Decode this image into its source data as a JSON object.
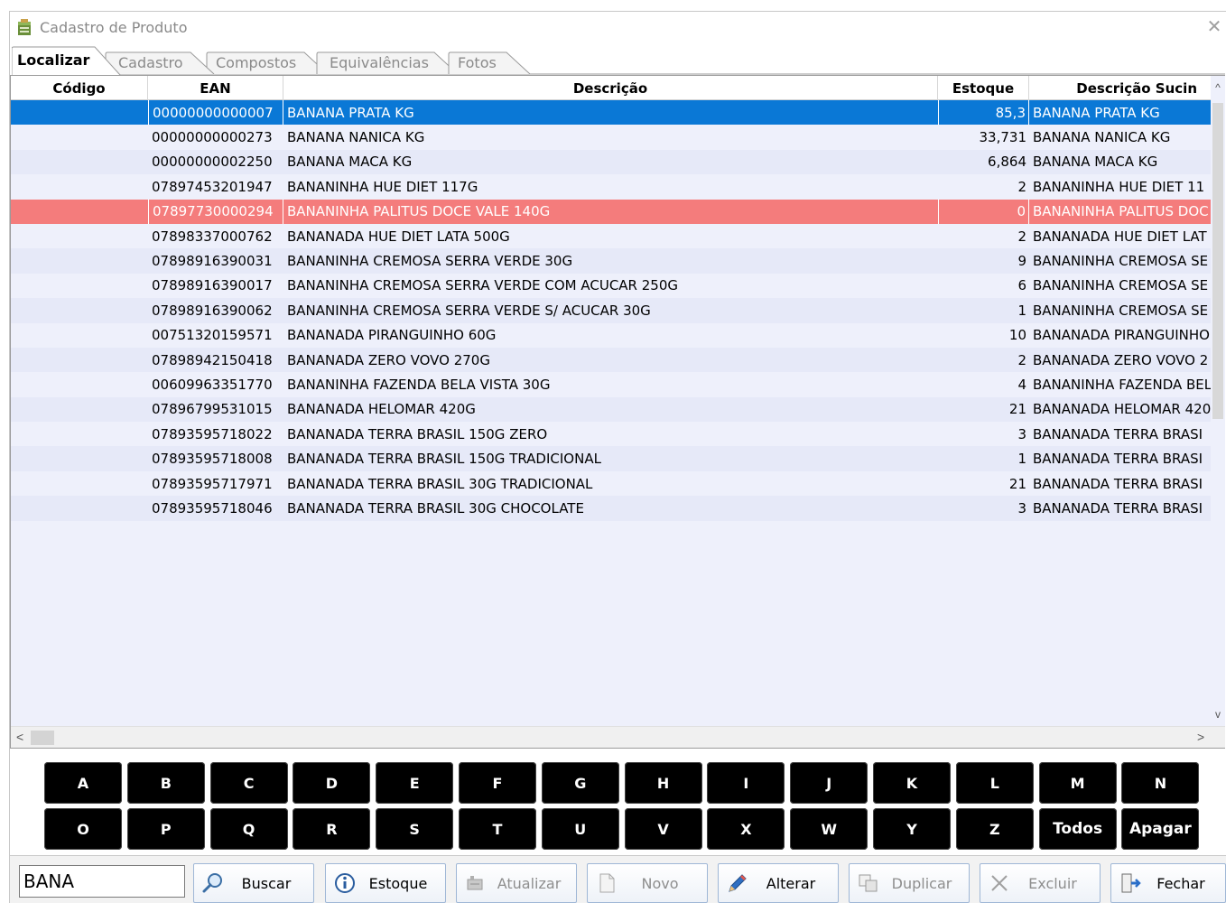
{
  "window": {
    "title": "Cadastro de Produto",
    "close_glyph": "✕"
  },
  "tabs": [
    {
      "label": "Localizar",
      "active": true
    },
    {
      "label": "Cadastro",
      "active": false
    },
    {
      "label": "Compostos",
      "active": false
    },
    {
      "label": "Equivalências",
      "active": false
    },
    {
      "label": "Fotos",
      "active": false
    }
  ],
  "grid": {
    "columns": [
      "Código",
      "EAN",
      "Descrição",
      "Estoque",
      "Descrição Sucin"
    ],
    "rows": [
      {
        "codigo": "",
        "ean": "00000000000007",
        "descricao": "BANANA PRATA KG",
        "estoque": "85,3",
        "desc_suc": "BANANA PRATA KG",
        "state": "selected"
      },
      {
        "codigo": "",
        "ean": "00000000000273",
        "descricao": "BANANA NANICA KG",
        "estoque": "33,731",
        "desc_suc": "BANANA NANICA KG",
        "state": "normal"
      },
      {
        "codigo": "",
        "ean": "00000000002250",
        "descricao": "BANANA MACA KG",
        "estoque": "6,864",
        "desc_suc": "BANANA MACA KG",
        "state": "normal"
      },
      {
        "codigo": "",
        "ean": "07897453201947",
        "descricao": "BANANINHA HUE DIET 117G",
        "estoque": "2",
        "desc_suc": "BANANINHA HUE DIET 11",
        "state": "normal"
      },
      {
        "codigo": "",
        "ean": "07897730000294",
        "descricao": "BANANINHA PALITUS DOCE VALE 140G",
        "estoque": "0",
        "desc_suc": "BANANINHA PALITUS DOC",
        "state": "alert"
      },
      {
        "codigo": "",
        "ean": "07898337000762",
        "descricao": "BANANADA HUE DIET LATA 500G",
        "estoque": "2",
        "desc_suc": "BANANADA HUE DIET LAT",
        "state": "normal"
      },
      {
        "codigo": "",
        "ean": "07898916390031",
        "descricao": "BANANINHA CREMOSA SERRA VERDE 30G",
        "estoque": "9",
        "desc_suc": "BANANINHA CREMOSA SE",
        "state": "normal"
      },
      {
        "codigo": "",
        "ean": "07898916390017",
        "descricao": "BANANINHA CREMOSA SERRA VERDE COM ACUCAR 250G",
        "estoque": "6",
        "desc_suc": "BANANINHA CREMOSA SE",
        "state": "normal"
      },
      {
        "codigo": "",
        "ean": "07898916390062",
        "descricao": "BANANINHA CREMOSA SERRA VERDE S/ ACUCAR 30G",
        "estoque": "1",
        "desc_suc": "BANANINHA CREMOSA SE",
        "state": "normal"
      },
      {
        "codigo": "",
        "ean": "00751320159571",
        "descricao": "BANANADA PIRANGUINHO 60G",
        "estoque": "10",
        "desc_suc": "BANANADA PIRANGUINHO",
        "state": "normal"
      },
      {
        "codigo": "",
        "ean": "07898942150418",
        "descricao": "BANANADA ZERO VOVO 270G",
        "estoque": "2",
        "desc_suc": "BANANADA ZERO VOVO 2",
        "state": "normal"
      },
      {
        "codigo": "",
        "ean": "00609963351770",
        "descricao": "BANANINHA FAZENDA BELA VISTA 30G",
        "estoque": "4",
        "desc_suc": "BANANINHA FAZENDA BEL",
        "state": "normal"
      },
      {
        "codigo": "",
        "ean": "07896799531015",
        "descricao": "BANANADA HELOMAR 420G",
        "estoque": "21",
        "desc_suc": "BANANADA HELOMAR 420",
        "state": "normal"
      },
      {
        "codigo": "",
        "ean": "07893595718022",
        "descricao": "BANANADA TERRA BRASIL 150G ZERO",
        "estoque": "3",
        "desc_suc": "BANANADA TERRA BRASI",
        "state": "normal"
      },
      {
        "codigo": "",
        "ean": "07893595718008",
        "descricao": "BANANADA TERRA BRASIL 150G TRADICIONAL",
        "estoque": "1",
        "desc_suc": "BANANADA TERRA BRASI",
        "state": "normal"
      },
      {
        "codigo": "",
        "ean": "07893595717971",
        "descricao": "BANANADA TERRA BRASIL 30G TRADICIONAL",
        "estoque": "21",
        "desc_suc": "BANANADA TERRA BRASI",
        "state": "normal"
      },
      {
        "codigo": "",
        "ean": "07893595718046",
        "descricao": "BANANADA TERRA BRASIL 30G CHOCOLATE",
        "estoque": "3",
        "desc_suc": "BANANADA TERRA BRASI",
        "state": "normal"
      }
    ],
    "scroll": {
      "up": "^",
      "down": "v",
      "left": "<",
      "right": ">"
    }
  },
  "keyboard": {
    "row1": [
      "A",
      "B",
      "C",
      "D",
      "E",
      "F",
      "G",
      "H",
      "I",
      "J",
      "K",
      "L",
      "M",
      "N"
    ],
    "row2": [
      "O",
      "P",
      "Q",
      "R",
      "S",
      "T",
      "U",
      "V",
      "X",
      "W",
      "Y",
      "Z",
      "Todos",
      "Apagar"
    ]
  },
  "bottombar": {
    "search_value": "BANA",
    "buttons": [
      {
        "label": "Buscar",
        "icon": "magnifier-icon",
        "enabled": true
      },
      {
        "label": "Estoque",
        "icon": "info-icon",
        "enabled": true
      },
      {
        "label": "Atualizar",
        "icon": "refresh-icon",
        "enabled": false
      },
      {
        "label": "Novo",
        "icon": "new-document-icon",
        "enabled": false
      },
      {
        "label": "Alterar",
        "icon": "pencil-icon",
        "enabled": true
      },
      {
        "label": "Duplicar",
        "icon": "duplicate-icon",
        "enabled": false
      },
      {
        "label": "Excluir",
        "icon": "delete-x-icon",
        "enabled": false
      },
      {
        "label": "Fechar",
        "icon": "exit-door-icon",
        "enabled": true
      }
    ]
  },
  "colors": {
    "selected_row": "#0a78d6",
    "alert_row": "#f47c7c",
    "row_odd": "#e6e9f8",
    "row_even": "#eef0fb",
    "key_bg": "#000000"
  }
}
